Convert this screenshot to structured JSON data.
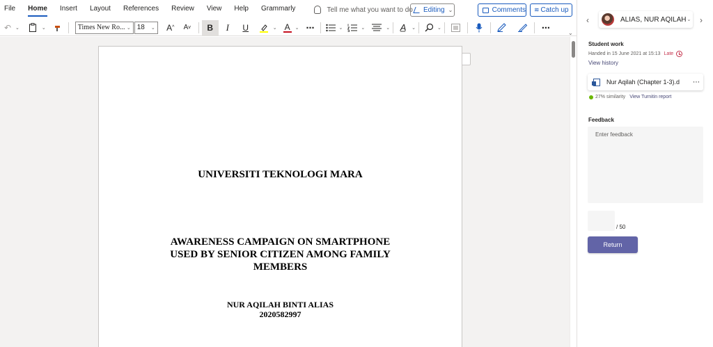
{
  "menu": {
    "items": [
      "File",
      "Home",
      "Insert",
      "Layout",
      "References",
      "Review",
      "View",
      "Help",
      "Grammarly"
    ],
    "active": "Home",
    "tell_me": "Tell me what you want to do",
    "editing": "Editing",
    "comments": "Comments",
    "catch_up": "Catch up"
  },
  "toolbar": {
    "font": "Times New Ro...",
    "size": "18",
    "grow": "A",
    "shrink": "A",
    "bold": "B",
    "italic": "I",
    "underline": "U",
    "highlight_color": "#ffff00",
    "font_color": "#c50f1f",
    "more": "⋯"
  },
  "document": {
    "university": "UNIVERSITI TEKNOLOGI MARA",
    "title_lines": [
      "AWARENESS CAMPAIGN ON SMARTPHONE",
      "USED BY SENIOR CITIZEN AMONG FAMILY",
      "MEMBERS"
    ],
    "student_name": "NUR AQILAH BINTI ALIAS",
    "student_id": "2020582997"
  },
  "panel": {
    "student": "ALIAS, NUR AQILAH",
    "student_work_label": "Student work",
    "handed_in": "Handed in 15 June 2021 at 15:13",
    "late": "Late",
    "view_history": "View history",
    "file_name": "Nur Aqilah (Chapter 1-3).d",
    "similarity": "27% similarity",
    "turnitin": "View Turnitin report",
    "feedback_label": "Feedback",
    "feedback_placeholder": "Enter feedback",
    "points_max": "/ 50",
    "return": "Return"
  },
  "colors": {
    "word_blue": "#185abd",
    "teams_purple": "#6264a7",
    "late_red": "#c4314b",
    "similarity_green": "#6bb700"
  }
}
